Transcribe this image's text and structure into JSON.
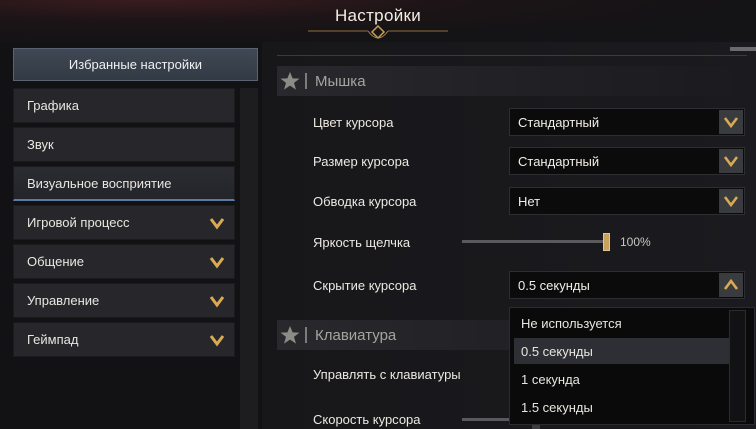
{
  "header": {
    "title": "Настройки"
  },
  "sidebar": {
    "favorites_label": "Избранные настройки",
    "items": [
      {
        "label": "Графика",
        "expandable": false,
        "active": false
      },
      {
        "label": "Звук",
        "expandable": false,
        "active": false
      },
      {
        "label": "Визуальное восприятие",
        "expandable": false,
        "active": true
      },
      {
        "label": "Игровой процесс",
        "expandable": true,
        "active": false
      },
      {
        "label": "Общение",
        "expandable": true,
        "active": false
      },
      {
        "label": "Управление",
        "expandable": true,
        "active": false
      },
      {
        "label": "Геймпад",
        "expandable": true,
        "active": false
      }
    ]
  },
  "sections": {
    "mouse": {
      "title": "Мышка"
    },
    "keyboard": {
      "title": "Клавиатура"
    }
  },
  "settings": {
    "cursor_color": {
      "label": "Цвет курсора",
      "value": "Стандартный"
    },
    "cursor_size": {
      "label": "Размер курсора",
      "value": "Стандартный"
    },
    "cursor_outline": {
      "label": "Обводка курсора",
      "value": "Нет"
    },
    "click_brightness": {
      "label": "Яркость щелчка",
      "value": "100%",
      "level": 1.0
    },
    "cursor_hide": {
      "label": "Скрытие курсора",
      "value": "0.5 секунды",
      "open": true,
      "options": [
        "Не используется",
        "0.5 секунды",
        "1 секунда",
        "1.5 секунды"
      ],
      "selected_index": 1
    },
    "keyboard_control": {
      "label": "Управлять с клавиатуры"
    },
    "cursor_speed": {
      "label": "Скорость курсора"
    }
  },
  "colors": {
    "accent_gold": "#c9a15c",
    "active_tab_underline": "#5d7aa7",
    "panel_bg": "#1b1b1f"
  },
  "icons": {
    "chevron": "chevron-down-icon",
    "chevron_up": "chevron-up-icon",
    "section_star": "star-icon",
    "header_ornament": "ornament-icon"
  }
}
